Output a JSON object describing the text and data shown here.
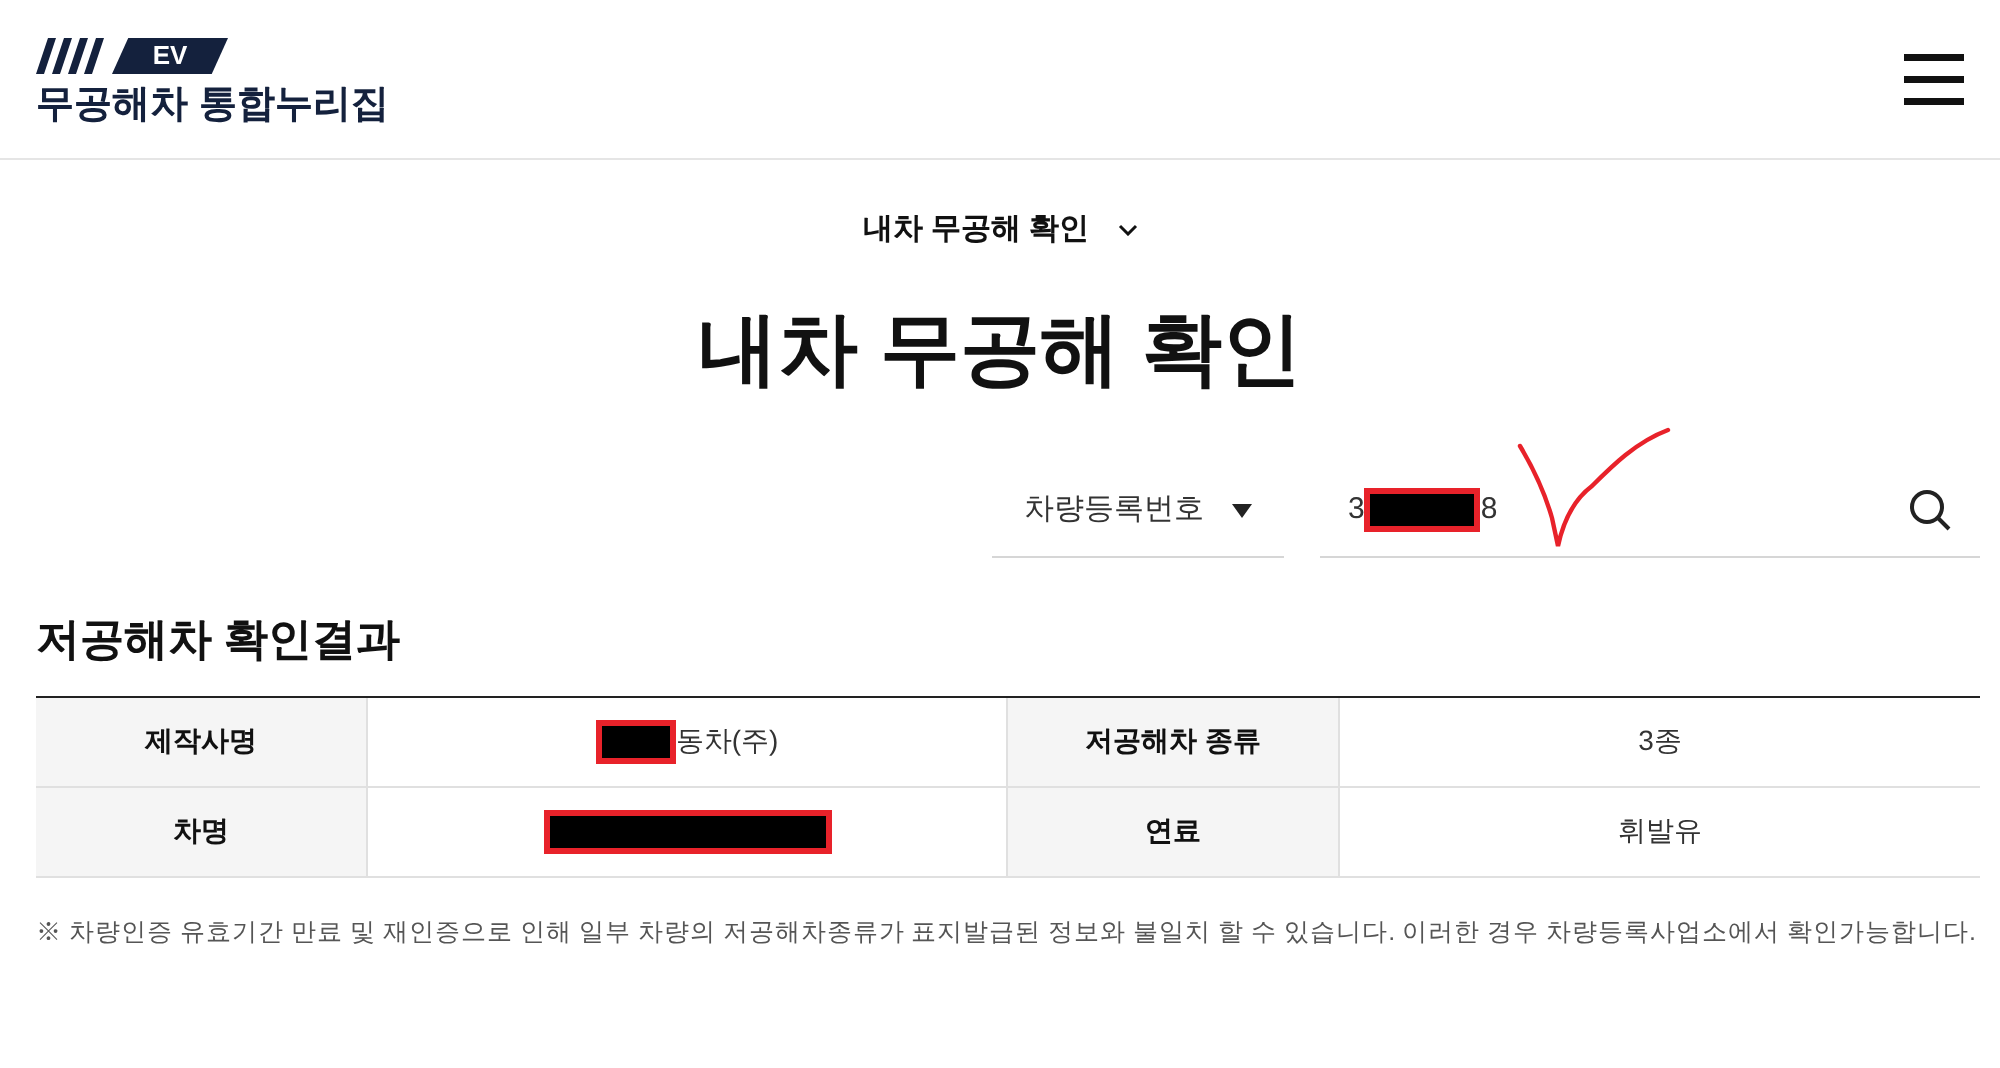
{
  "header": {
    "logo_badge": "EV",
    "site_title": "무공해차 통합누리집"
  },
  "breadcrumb": {
    "label": "내차 무공해 확인"
  },
  "page_title": "내차 무공해 확인",
  "search": {
    "select": "차량등록번호",
    "value_start": "3",
    "value_end": "8",
    "redacted": true,
    "annotated": true
  },
  "result": {
    "title": "저공해차 확인결과",
    "rows": [
      {
        "cells": [
          {
            "kind": "header",
            "text": "제작사명"
          },
          {
            "kind": "value",
            "text": "동차(주)",
            "redacted": true
          },
          {
            "kind": "header",
            "text": "저공해차 종류"
          },
          {
            "kind": "value",
            "text": "3종"
          }
        ]
      },
      {
        "cells": [
          {
            "kind": "header",
            "text": "차명"
          },
          {
            "kind": "value",
            "text": "",
            "redacted": true
          },
          {
            "kind": "header",
            "text": "연료"
          },
          {
            "kind": "value",
            "text": "휘발유"
          }
        ]
      }
    ]
  },
  "note": "※ 차량인증 유효기간 만료 및 재인증으로 인해 일부 차량의 저공해차종류가 표지발급된 정보와 불일치 할 수 있습니다. 이러한 경우 차량등록사업소에서 확인가능합니다."
}
